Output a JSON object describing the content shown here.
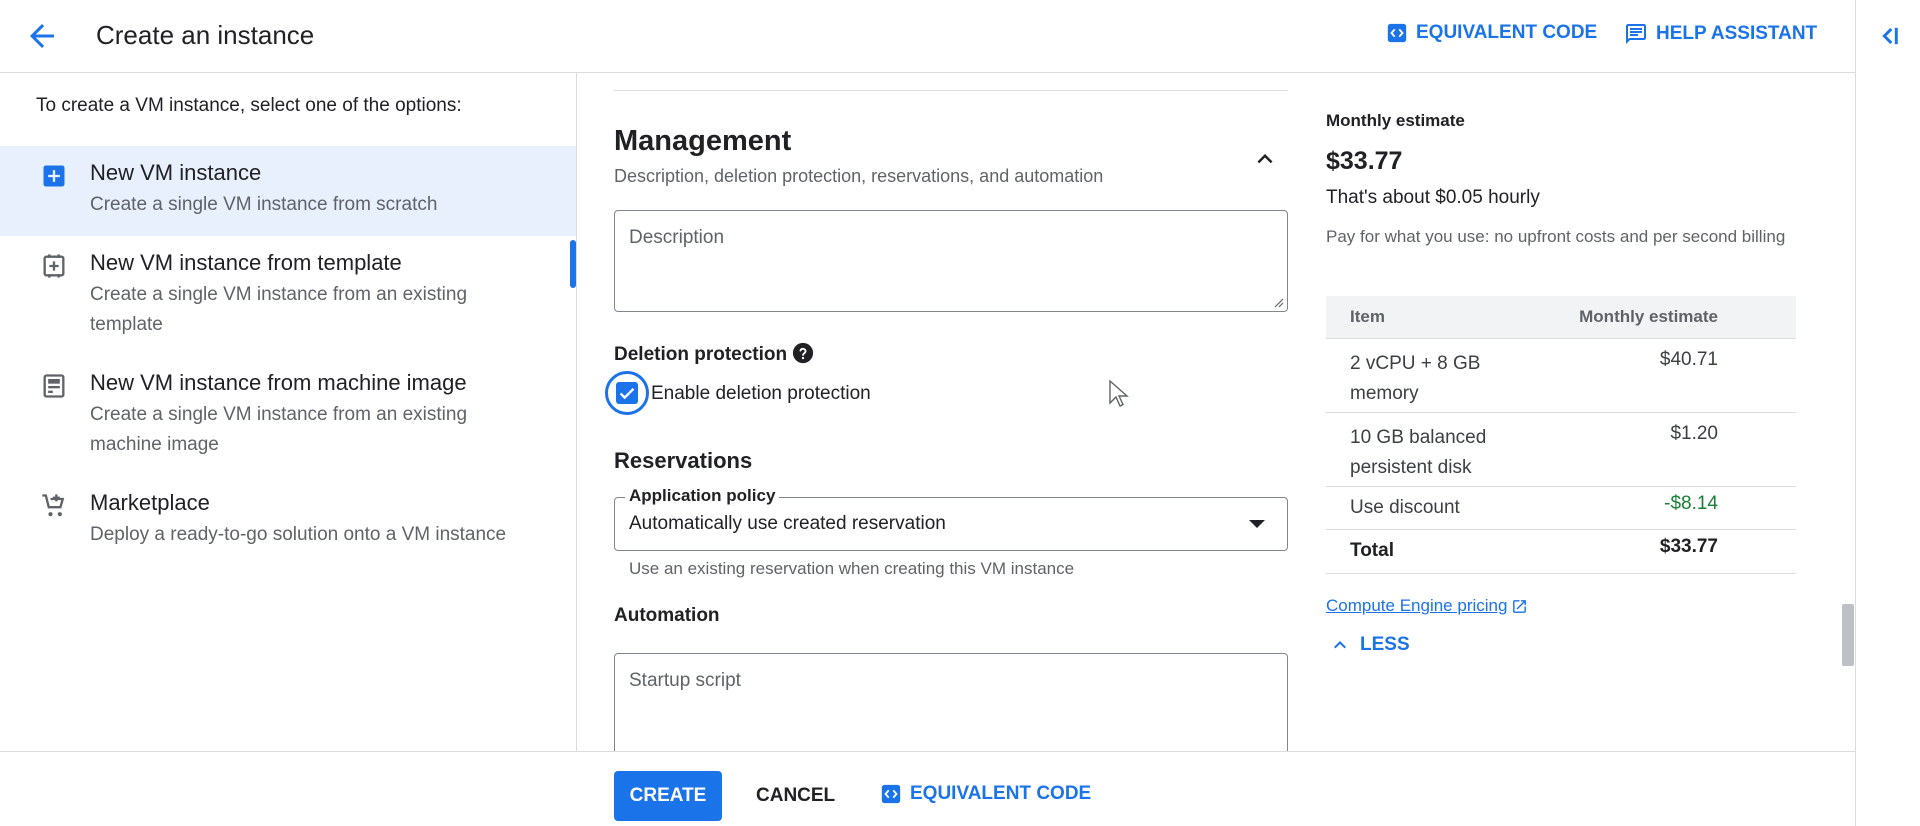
{
  "header": {
    "title": "Create an instance",
    "equivalent_code": "EQUIVALENT CODE",
    "help_assistant": "HELP ASSISTANT"
  },
  "sidebar": {
    "prompt": "To create a VM instance, select one of the options:",
    "options": [
      {
        "title": "New VM instance",
        "desc": "Create a single VM instance from scratch",
        "icon": "add-box-icon",
        "selected": true
      },
      {
        "title": "New VM instance from template",
        "desc": "Create a single VM instance from an existing template",
        "icon": "template-icon",
        "selected": false
      },
      {
        "title": "New VM instance from machine image",
        "desc": "Create a single VM instance from an existing machine image",
        "icon": "machine-image-icon",
        "selected": false
      },
      {
        "title": "Marketplace",
        "desc": "Deploy a ready-to-go solution onto a VM instance",
        "icon": "cart-icon",
        "selected": false
      }
    ]
  },
  "management": {
    "title": "Management",
    "subtitle": "Description, deletion protection, reservations, and automation",
    "description_placeholder": "Description",
    "deletion_protection_label": "Deletion protection",
    "enable_deletion_protection": "Enable deletion protection",
    "deletion_protection_checked": true,
    "reservations_title": "Reservations",
    "application_policy_label": "Application policy",
    "application_policy_value": "Automatically use created reservation",
    "application_policy_hint": "Use an existing reservation when creating this VM instance",
    "automation_label": "Automation",
    "startup_script_placeholder": "Startup script"
  },
  "estimate": {
    "title": "Monthly estimate",
    "price": "$33.77",
    "hourly": "That's about $0.05 hourly",
    "note": "Pay for what you use: no upfront costs and per second billing",
    "table_headers": {
      "item": "Item",
      "estimate": "Monthly estimate"
    },
    "rows": [
      {
        "item": "2 vCPU + 8 GB memory",
        "amount": "$40.71"
      },
      {
        "item": "10 GB balanced persistent disk",
        "amount": "$1.20"
      },
      {
        "item": "Use discount",
        "amount": "-$8.14"
      },
      {
        "item": "Total",
        "amount": "$33.77"
      }
    ],
    "pricing_link": "Compute Engine pricing",
    "less": "LESS"
  },
  "footer": {
    "create": "CREATE",
    "cancel": "CANCEL",
    "equivalent_code": "EQUIVALENT CODE"
  },
  "colors": {
    "accent": "#1a73e8",
    "selected_bg": "#e8f0fe",
    "discount": "#188038"
  }
}
